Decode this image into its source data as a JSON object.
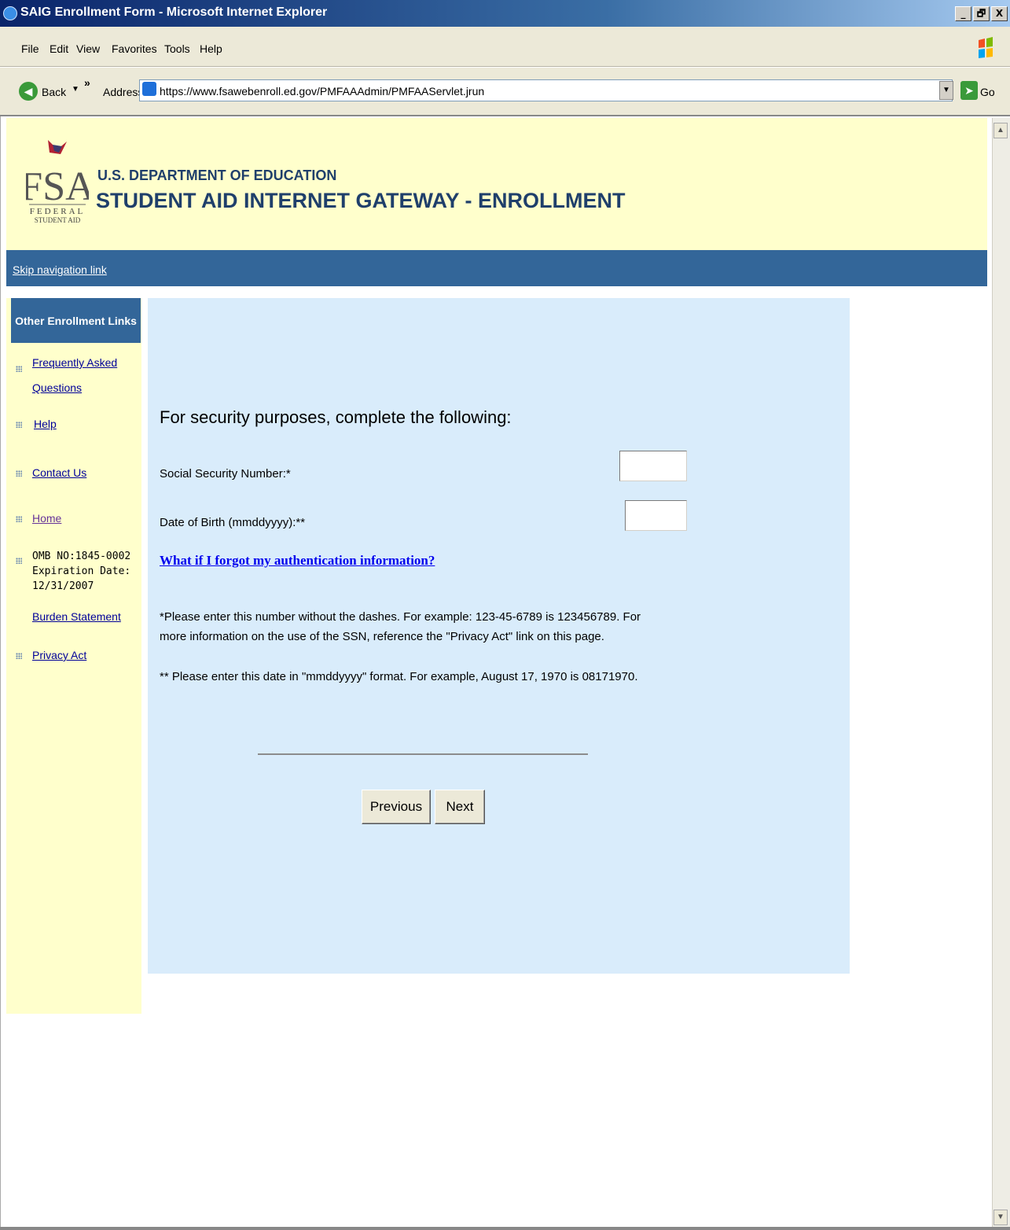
{
  "window": {
    "title": "SAIG Enrollment Form - Microsoft Internet Explorer",
    "minimize": "_",
    "restore": "🗗",
    "close": "X"
  },
  "menu": [
    "File",
    "Edit",
    "View",
    "Favorites",
    "Tools",
    "Help"
  ],
  "toolbar": {
    "back_label": "Back",
    "address_label": "Address",
    "url": "https://www.fsawebenroll.ed.gov/PMFAAAdmin/PMFAAServlet.jrun",
    "go_label": "Go"
  },
  "header": {
    "logo_text": "FSA",
    "logo_sub1": "FEDERAL",
    "logo_sub2": "STUDENT AID",
    "department": "U.S. DEPARTMENT OF EDUCATION",
    "gateway": "STUDENT AID INTERNET GATEWAY - ENROLLMENT"
  },
  "nav": {
    "skip_link": "Skip navigation link"
  },
  "sidebar": {
    "heading": "Other Enrollment Links",
    "links": {
      "faq_line1": "Frequently Asked",
      "faq_line2": "Questions",
      "help": "Help",
      "contact": "Contact Us",
      "home": "Home",
      "burden": "Burden Statement",
      "privacy": "Privacy Act"
    },
    "omb": {
      "line1": "OMB NO:1845-0002",
      "line2": "Expiration Date:",
      "line3": "12/31/2007"
    }
  },
  "form": {
    "heading": "For security purposes, complete the following:",
    "ssn_label": "Social Security Number:*",
    "ssn_value": "",
    "dob_label": "Date of Birth (mmddyyyy):**",
    "dob_value": "",
    "forgot_link": "What if I forgot my authentication information?",
    "note_ssn": "*Please enter this number without the dashes. For example: 123-45-6789 is 123456789. For more information on the use of the SSN, reference the \"Privacy Act\" link on this page.",
    "note_dob": "** Please enter this date in \"mmddyyyy\" format. For example, August 17, 1970 is 08171970.",
    "previous_button": "Previous",
    "next_button": "Next"
  },
  "colors": {
    "header_bg": "#ffffcc",
    "nav_bg": "#336699",
    "content_bg": "#d9ecfb",
    "link": "#000099"
  }
}
